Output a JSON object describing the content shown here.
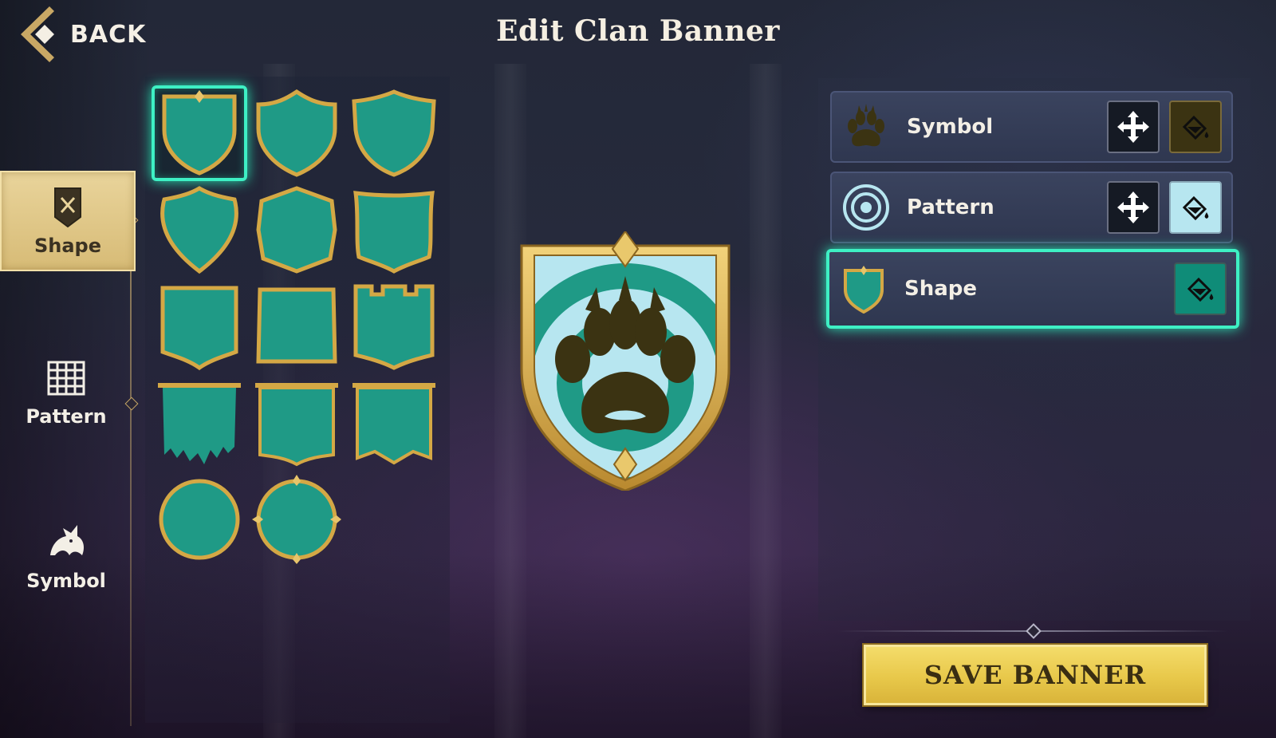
{
  "header": {
    "back_label": "BACK",
    "title": "Edit Clan Banner"
  },
  "categories": [
    {
      "id": "shape",
      "label": "Shape",
      "icon": "shield-swords-icon",
      "active": true
    },
    {
      "id": "pattern",
      "label": "Pattern",
      "icon": "pattern-grid-icon",
      "active": false
    },
    {
      "id": "symbol",
      "label": "Symbol",
      "icon": "dragon-icon",
      "active": false
    }
  ],
  "shapes": {
    "selected_index": 0,
    "items": [
      "heater-shield",
      "pointed-shield",
      "pointed-shield-wide",
      "heater-shield-2",
      "octagon-shield",
      "square-shield",
      "rounded-banner",
      "square-banner",
      "crenellated-banner",
      "tattered-banner",
      "square-flag",
      "swallowtail-flag",
      "round-shield",
      "round-shield-ornate"
    ]
  },
  "layers": [
    {
      "label": "Symbol",
      "icon": "paw-icon",
      "has_move": true,
      "paint_color": "#3b3312",
      "selected": false
    },
    {
      "label": "Pattern",
      "icon": "target-rings-icon",
      "has_move": true,
      "paint_color": "#b7e6f0",
      "selected": false
    },
    {
      "label": "Shape",
      "icon": "shield-icon",
      "has_move": false,
      "paint_color": "#0f8c78",
      "selected": true
    }
  ],
  "colors": {
    "accent_teal": "#3ef0c4",
    "shape_fill": "#1f9a86",
    "gold": "#d4a845",
    "pattern_light": "#b7e6f0",
    "symbol_dark": "#3b3312"
  },
  "actions": {
    "save_label": "SAVE BANNER"
  }
}
